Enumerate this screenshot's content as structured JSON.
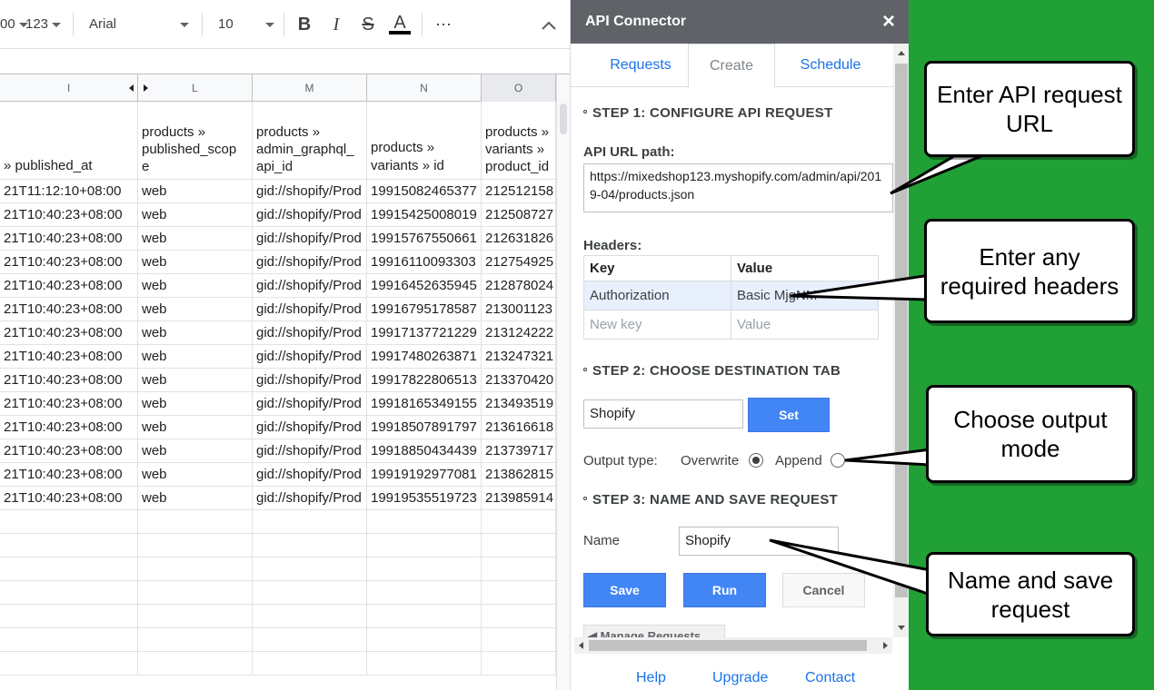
{
  "toolbar": {
    "zoom_partial": "00",
    "number_format": "123",
    "font": "Arial",
    "font_size": "10",
    "bold": "B",
    "italic": "I",
    "strike": "S",
    "text_color": "A",
    "more": "⋯",
    "collapse": "⌃"
  },
  "sheet": {
    "columns": [
      {
        "label": "I",
        "selected": false
      },
      {
        "label": "L",
        "selected": false
      },
      {
        "label": "M",
        "selected": false
      },
      {
        "label": "N",
        "selected": false
      },
      {
        "label": "O",
        "selected": true
      }
    ],
    "header_row": [
      [
        "» published_at"
      ],
      [
        "products »",
        "published_scop",
        "e"
      ],
      [
        "products »",
        "admin_graphql_",
        "api_id"
      ],
      [
        "products »",
        "variants » id"
      ],
      [
        "products »",
        "variants »",
        "product_id"
      ]
    ],
    "rows": [
      [
        "21T11:12:10+08:00",
        "web",
        "gid://shopify/Prod",
        "19915082465377",
        "212512158"
      ],
      [
        "21T10:40:23+08:00",
        "web",
        "gid://shopify/Prod",
        "19915425008019",
        "212508727"
      ],
      [
        "21T10:40:23+08:00",
        "web",
        "gid://shopify/Prod",
        "19915767550661",
        "212631826"
      ],
      [
        "21T10:40:23+08:00",
        "web",
        "gid://shopify/Prod",
        "19916110093303",
        "212754925"
      ],
      [
        "21T10:40:23+08:00",
        "web",
        "gid://shopify/Prod",
        "19916452635945",
        "212878024"
      ],
      [
        "21T10:40:23+08:00",
        "web",
        "gid://shopify/Prod",
        "19916795178587",
        "213001123"
      ],
      [
        "21T10:40:23+08:00",
        "web",
        "gid://shopify/Prod",
        "19917137721229",
        "213124222"
      ],
      [
        "21T10:40:23+08:00",
        "web",
        "gid://shopify/Prod",
        "19917480263871",
        "213247321"
      ],
      [
        "21T10:40:23+08:00",
        "web",
        "gid://shopify/Prod",
        "19917822806513",
        "213370420"
      ],
      [
        "21T10:40:23+08:00",
        "web",
        "gid://shopify/Prod",
        "19918165349155",
        "213493519"
      ],
      [
        "21T10:40:23+08:00",
        "web",
        "gid://shopify/Prod",
        "19918507891797",
        "213616618"
      ],
      [
        "21T10:40:23+08:00",
        "web",
        "gid://shopify/Prod",
        "19918850434439",
        "213739717"
      ],
      [
        "21T10:40:23+08:00",
        "web",
        "gid://shopify/Prod",
        "19919192977081",
        "213862815"
      ],
      [
        "21T10:40:23+08:00",
        "web",
        "gid://shopify/Prod",
        "19919535519723",
        "213985914"
      ]
    ],
    "empty_rows": 7
  },
  "sidebar": {
    "title": "API Connector",
    "close": "×",
    "tabs": [
      {
        "label": "Requests",
        "active": false
      },
      {
        "label": "Create",
        "active": true
      },
      {
        "label": "Schedule",
        "active": false
      }
    ],
    "step1": "STEP 1: CONFIGURE API REQUEST",
    "url_label": "API URL path:",
    "url_value": "https://mixedshop123.myshopify.com/admin/api/2019-04/products.json",
    "headers_label": "Headers:",
    "headers": {
      "key_col": "Key",
      "value_col": "Value",
      "auth_key": "Authorization",
      "auth_value": "Basic MjgNM",
      "new_key_placeholder": "New key",
      "new_value_placeholder": "Value"
    },
    "step2": "STEP 2: CHOOSE DESTINATION TAB",
    "destination_value": "Shopify",
    "set_label": "Set",
    "output_type_label": "Output type:",
    "overwrite_label": "Overwrite",
    "append_label": "Append",
    "selected_output": "Overwrite",
    "step3": "STEP 3: NAME AND SAVE REQUEST",
    "name_label": "Name",
    "name_value": "Shopify",
    "save_label": "Save",
    "run_label": "Run",
    "cancel_label": "Cancel",
    "partial_button": "◀ Manage Requests",
    "footer": {
      "help": "Help",
      "upgrade": "Upgrade",
      "contact": "Contact"
    }
  },
  "callouts": {
    "url": "Enter API request URL",
    "headers": "Enter any required headers",
    "output": "Choose output mode",
    "save": "Name and save request"
  },
  "colors": {
    "green_background": "#21a036",
    "sidebar_title_bar": "#5f6368",
    "primary_button": "#4285f4",
    "link": "#1a73e8"
  }
}
